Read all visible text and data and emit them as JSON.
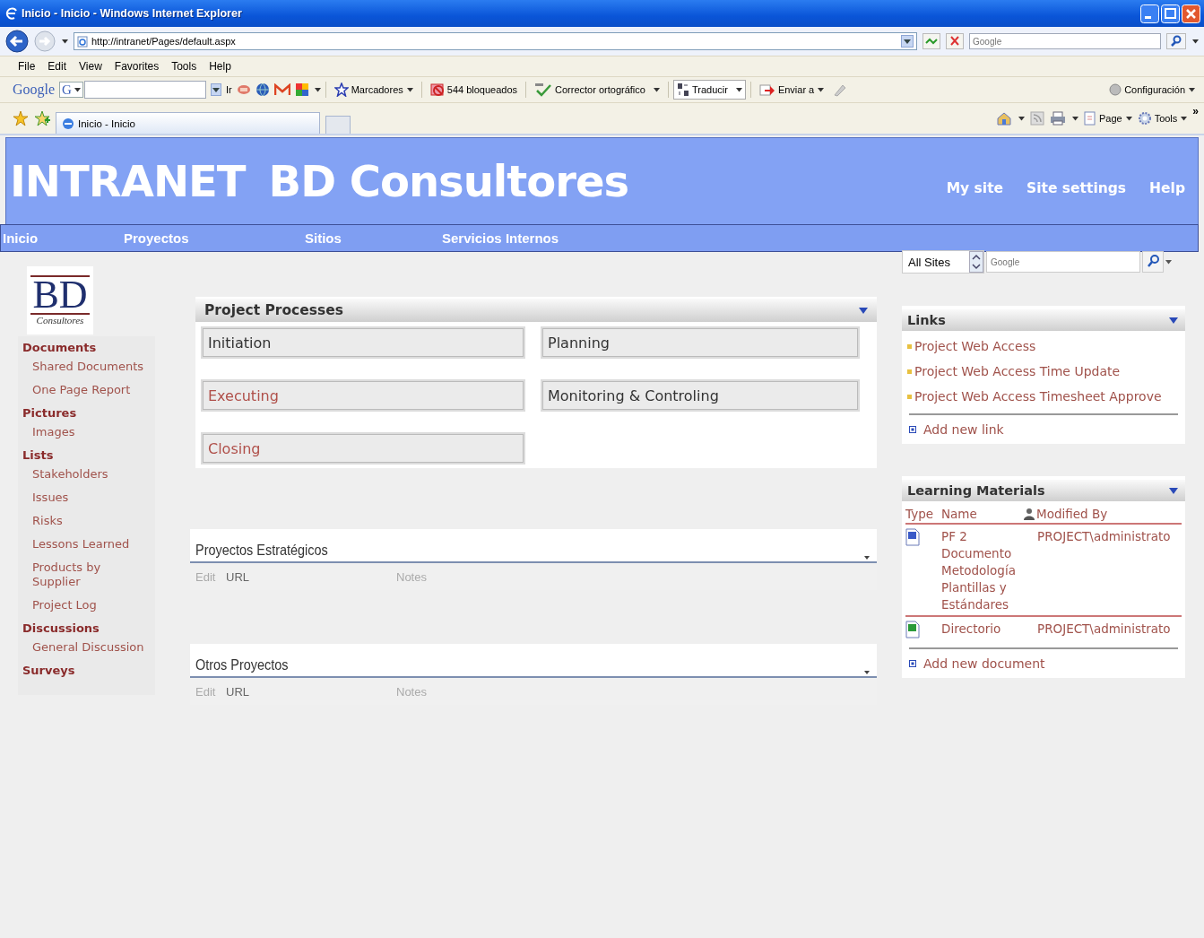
{
  "window": {
    "title": "Inicio - Inicio - Windows Internet Explorer"
  },
  "address_bar": {
    "url": "http://intranet/Pages/default.aspx"
  },
  "browser_search": {
    "placeholder": "Google"
  },
  "menu": [
    "File",
    "Edit",
    "View",
    "Favorites",
    "Tools",
    "Help"
  ],
  "google_toolbar": {
    "logo": "Google",
    "button": "G",
    "go": "Ir",
    "items": [
      {
        "label": "Marcadores",
        "kind": "menu"
      },
      {
        "label": "544 bloqueados",
        "kind": "button"
      },
      {
        "label": "Corrector ortográfico",
        "kind": "split"
      },
      {
        "label": "Traducir",
        "kind": "split"
      },
      {
        "label": "Enviar a",
        "kind": "menu"
      }
    ],
    "settings": "Configuración"
  },
  "tabs": [
    {
      "label": "Inicio - Inicio",
      "selected": true
    }
  ],
  "command_bar": {
    "items": [
      "Page",
      "Tools"
    ],
    "more": "»"
  },
  "site_header": {
    "title": [
      "INTRANET",
      "BD Consultores"
    ],
    "links": [
      "My site",
      "Site settings",
      "Help"
    ]
  },
  "top_nav": [
    "Inicio",
    "Proyectos",
    "Sitios",
    "Servicios Internos"
  ],
  "logo": {
    "letters": "BD",
    "caption": "Consultores"
  },
  "quick_launch": [
    {
      "heading": "Documents",
      "items": [
        "Shared Documents",
        "One Page Report"
      ]
    },
    {
      "heading": "Pictures",
      "items": [
        "Images"
      ]
    },
    {
      "heading": "Lists",
      "items": [
        "Stakeholders",
        "Issues",
        "Risks",
        "Lessons Learned",
        "Products by Supplier",
        "Project Log"
      ]
    },
    {
      "heading": "Discussions",
      "items": [
        "General Discussion"
      ]
    },
    {
      "heading": "Surveys"
    }
  ],
  "project_processes": {
    "title": "Project Processes",
    "tiles": [
      {
        "label": "Initiation",
        "color": "#333333"
      },
      {
        "label": "Planning",
        "color": "#333333"
      },
      {
        "label": "Executing",
        "color": "#b0504a"
      },
      {
        "label": "Monitoring & Controling",
        "color": "#333333"
      },
      {
        "label": "Closing",
        "color": "#b0504a"
      }
    ]
  },
  "lists": [
    {
      "title": "Proyectos Estratégicos",
      "columns": [
        "Edit",
        "URL",
        "Notes"
      ]
    },
    {
      "title": "Otros Proyectos",
      "columns": [
        "Edit",
        "URL",
        "Notes"
      ]
    }
  ],
  "site_search": {
    "scope": "All Sites",
    "placeholder": "Google"
  },
  "links": {
    "title": "Links",
    "items": [
      "Project Web Access",
      "Project Web Access Time Update",
      "Project Web Access Timesheet Approve"
    ],
    "add": "Add new link"
  },
  "learning_materials": {
    "title": "Learning Materials",
    "columns": [
      "Type",
      "Name",
      "Modified By"
    ],
    "rows": [
      {
        "kind": "word",
        "name": "PF 2 Documento Metodología Plantillas y Estándares",
        "modified_by": "PROJECT\\administrato"
      },
      {
        "kind": "excel",
        "name": "Directorio",
        "modified_by": "PROJECT\\administrato"
      }
    ],
    "add": "Add new document"
  }
}
